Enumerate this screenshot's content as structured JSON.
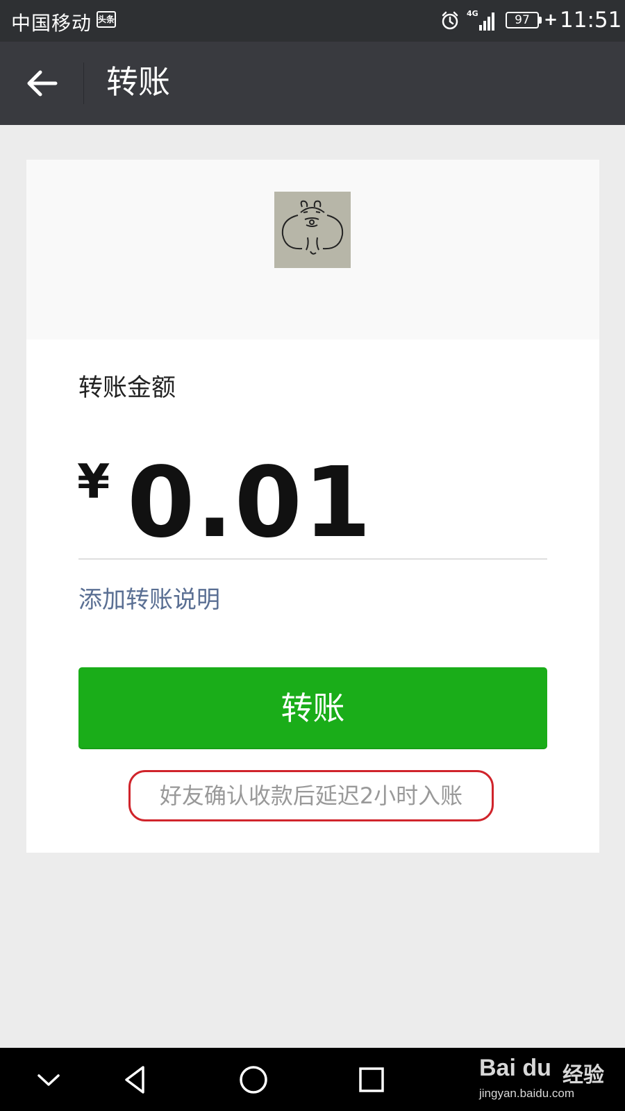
{
  "status_bar": {
    "carrier": "中国移动",
    "carrier_badge": "头条",
    "network": "4G",
    "battery": "97",
    "charging_symbol": "+",
    "time": "11:51"
  },
  "header": {
    "title": "转账",
    "back_icon": "arrow-left-icon"
  },
  "transfer": {
    "amount_label": "转账金额",
    "currency_symbol": "¥",
    "amount": "0.01",
    "add_note_link": "添加转账说明",
    "submit_button": "转账",
    "notice": "好友确认收款后延迟2小时入账"
  },
  "nav_bar": {
    "icons": [
      "chevron-down-icon",
      "back-triangle-icon",
      "home-circle-icon",
      "recents-square-icon"
    ]
  },
  "watermark": {
    "brand": "Bai du",
    "suffix": "经验",
    "url": "jingyan.baidu.com"
  },
  "colors": {
    "title_bar": "#393a3f",
    "status_bar": "#2e3033",
    "primary_button": "#1aad19",
    "link": "#5a6f93",
    "highlight_outline": "#d0242b",
    "background": "#ececec"
  }
}
